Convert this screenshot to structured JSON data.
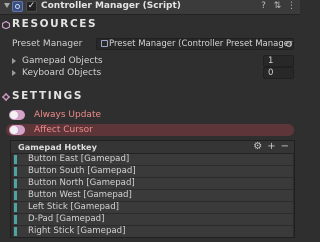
{
  "header": {
    "title": "Controller Manager (Script)",
    "checked": "✓",
    "icons": [
      "help-icon",
      "preset-icon",
      "more-icon"
    ]
  },
  "resources": {
    "title": "RESOURCES",
    "preset_label": "Preset Manager",
    "preset_value": "Preset Manager (Controller Preset Manager)",
    "gamepad_label": "Gamepad Objects",
    "gamepad_count": "1",
    "keyboard_label": "Keyboard Objects",
    "keyboard_count": "0"
  },
  "settings": {
    "title": "SETTINGS",
    "always_update": "Always Update",
    "affect_cursor": "Affect Cursor",
    "always_update_on": false,
    "affect_cursor_on": true
  },
  "hotkeys": {
    "title": "Gamepad Hotkey",
    "items": [
      "Button East [Gamepad]",
      "Button South [Gamepad]",
      "Button North [Gamepad]",
      "Button West [Gamepad]",
      "Left Stick [Gamepad]",
      "D-Pad [Gamepad]",
      "Right Stick [Gamepad]"
    ]
  },
  "colors": {
    "accent": "#d3a2c9",
    "warning_text": "#f08b8b",
    "handle": "#4fa3a0"
  }
}
